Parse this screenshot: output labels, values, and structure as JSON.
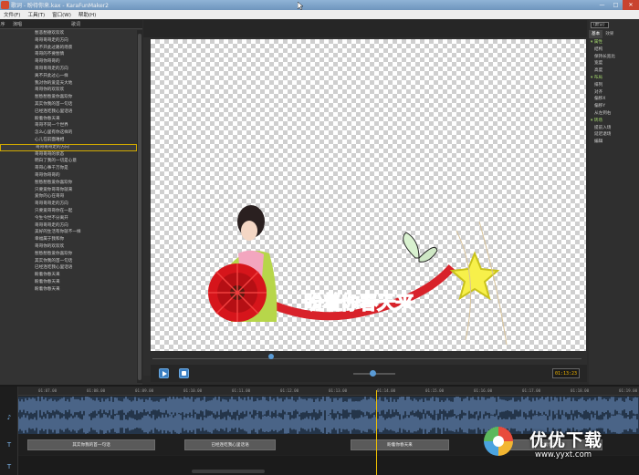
{
  "window": {
    "title": "歌词 - 盼待你来.kax - KaraFunMaker2",
    "minimize": "—",
    "maximize": "□",
    "close": "✕"
  },
  "menu": [
    "文件(F)",
    "工具(T)",
    "窗口(W)",
    "帮助(H)"
  ],
  "lyrics_panel": {
    "col_index": "序",
    "col_singer": "演唱",
    "col_lyric": "歌词",
    "rows": [
      "愁悲愁德欢欢欢",
      "哥哥哥哥走的方向",
      "离不开此过路的场景",
      "哥哥的不要愁情",
      "哥哥你哥哥的",
      "哥哥哥哥走的方向",
      "离不开此过心一样",
      "我对你的爱是天大地",
      "哥哥你的欢欢欢",
      "愁愁愁愁爱你喜欢你",
      "其实你我的首一句话",
      "已经连吃我心里话语",
      "盼着你春天来",
      "哥哥不同一个世界",
      "怎么心里有你这样的",
      "心儿在前面难相",
      "哥哥哥哥走的方向",
      "哥哥哥哥的状态",
      "明白了我的一切是心意",
      "哥哥心事千万你是",
      "哥哥你哥哥的",
      "愁愁愁愁爱你喜欢你",
      "只要爱你哥哥你就来",
      "爱你的心在哥哥",
      "哥哥哥哥走的方向",
      "只要爱哥哥你在一起",
      "今生今世不分离开",
      "哥哥哥哥走的方向",
      "美好的生活有你就不一样",
      "幸福属于我和你",
      "哥哥你的欢欢欢",
      "愁愁愁愁爱你喜欢你",
      "其实你我的首一句话",
      "已经连吃我心里话语",
      "盼着你春天来",
      "盼着你春天来",
      "盼着你春天来"
    ],
    "selected_index": 16
  },
  "stage": {
    "lyric_sung": "盼着",
    "lyric_unsung": "你春天来"
  },
  "transport": {
    "time": "01:13:23",
    "volume": 0.45
  },
  "props": {
    "dropdown": "(默认)",
    "tabs": [
      "基本",
      "效果"
    ],
    "items": [
      {
        "type": "section",
        "label": "属性"
      },
      {
        "type": "item",
        "label": "结构"
      },
      {
        "type": "item",
        "label": "保持长宽比"
      },
      {
        "type": "item",
        "label": "宽度"
      },
      {
        "type": "item",
        "label": "高度"
      },
      {
        "type": "section",
        "label": "布局"
      },
      {
        "type": "item",
        "label": "排列"
      },
      {
        "type": "item",
        "label": "对齐"
      },
      {
        "type": "item",
        "label": "偏移X"
      },
      {
        "type": "item",
        "label": "偏移Y"
      },
      {
        "type": "item",
        "label": "从左到右"
      },
      {
        "type": "section",
        "label": "转场"
      },
      {
        "type": "item",
        "label": "提前入场"
      },
      {
        "type": "item",
        "label": "延迟退场"
      },
      {
        "type": "item",
        "label": "编辑"
      }
    ]
  },
  "timeline": {
    "ticks": [
      "01:07.00",
      "01:08.00",
      "01:09.00",
      "01:10.00",
      "01:11.00",
      "01:12.00",
      "01:13.00",
      "01:14.00",
      "01:15.00",
      "01:16.00",
      "01:17.00",
      "01:18.00",
      "01:19.00"
    ],
    "segments": [
      "其实你我的首一句话",
      "已经连吃我心里话语",
      "盼着你春天来",
      "盼着你春天来"
    ]
  },
  "watermark": {
    "title": "优优下载",
    "url": "www.yyxt.com"
  }
}
